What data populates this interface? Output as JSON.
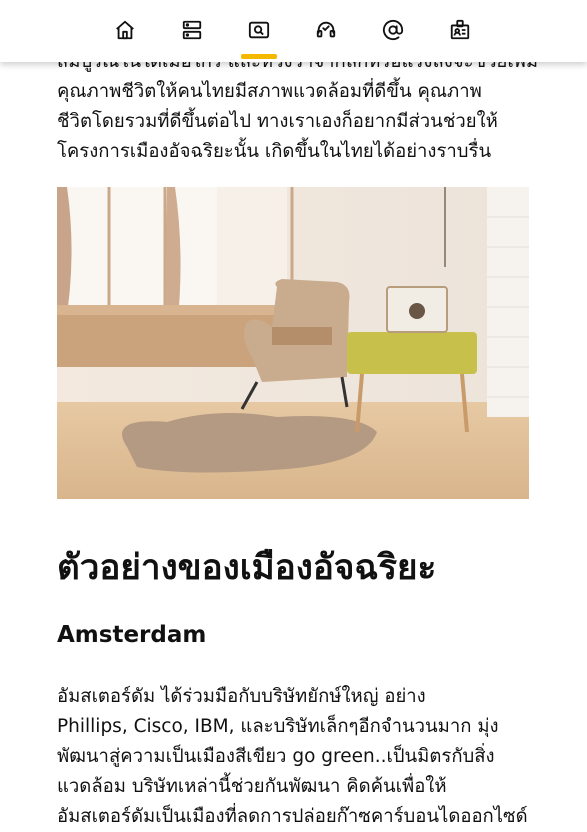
{
  "nav": {
    "items": [
      {
        "icon": "home-icon",
        "active": false
      },
      {
        "icon": "server-icon",
        "active": false
      },
      {
        "icon": "search-card-icon",
        "active": true
      },
      {
        "icon": "support-headset-icon",
        "active": false
      },
      {
        "icon": "at-sign-icon",
        "active": false
      },
      {
        "icon": "id-badge-icon",
        "active": false
      }
    ],
    "accent_color": "#f5b800"
  },
  "article": {
    "intro_lines": [
      "สมบูรณ์ในใดเมือใกร และหวังว่าจากลักหรือแรงลงจะช่วยเพิ่ม",
      "คุณภาพชีวิตให้คนไทยมีสภาพแวดล้อมที่ดีขึ้น คุณภาพ",
      "ชีวิตโดยรวมที่ดีขึ้นต่อไป ทางเราเองก็อยากมีส่วนช่วยให้",
      "โครงการเมืองอัจฉริยะนั้น เกิดขึ้นในไทยได้อย่างราบรื่น"
    ],
    "heading": "ตัวอย่างของเมืองอัจฉริยะ",
    "subheading": "Amsterdam",
    "body_lines": [
      "อัมสเตอร์ดัม ได้ร่วมมือกับบริษัทยักษ์ใหญ่ อย่าง",
      "Phillips, Cisco, IBM, และบริษัทเล็กๆอีกจำนวนมาก มุ่ง",
      "พัฒนาสู่ความเป็นเมืองสีเขียว go green..เป็นมิตรกับสิ่ง",
      "แวดล้อม บริษัทเหล่านี้ช่วยกันพัฒนา คิดค้นเพื่อให้",
      "อัมสเตอร์ดัมเป็นเมืองที่ลดการปล่อยก๊าซคาร์บอนไดออกไซด์"
    ]
  }
}
